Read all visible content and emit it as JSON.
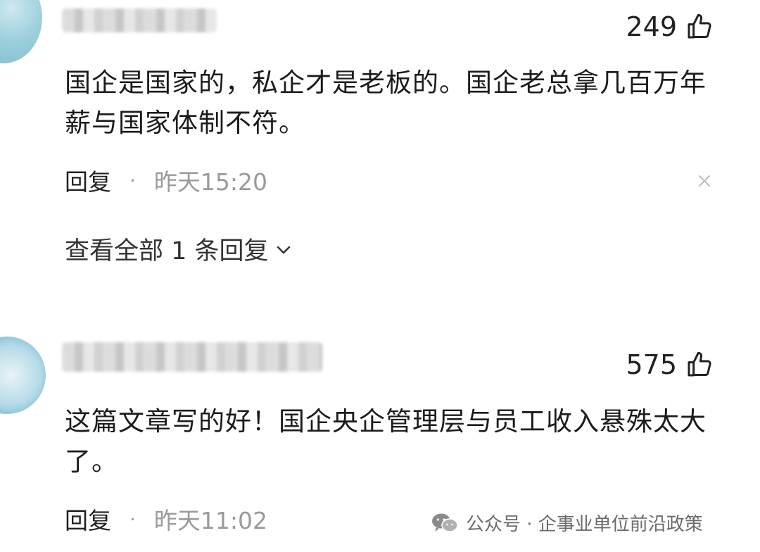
{
  "comments": [
    {
      "likes": "249",
      "text_line1": "国企是国家的，私企才是老板的。国企老总拿几百万年",
      "text_line2": "薪与国家体制不符。",
      "reply_label": "回复",
      "separator": "·",
      "time": "昨天15:20",
      "view_replies": "查看全部 1 条回复"
    },
    {
      "likes": "575",
      "text_line1": "这篇文章写的好！国企央企管理层与员工收入悬殊太大",
      "text_line2": "了。",
      "reply_label": "回复",
      "separator": "·",
      "time": "昨天11:02"
    }
  ],
  "watermark": {
    "text": "公众号 · 企事业单位前沿政策"
  },
  "icons": {
    "like": "thumbs-up-icon",
    "close": "close-icon",
    "expand": "chevron-down-icon",
    "wechat": "wechat-icon"
  }
}
